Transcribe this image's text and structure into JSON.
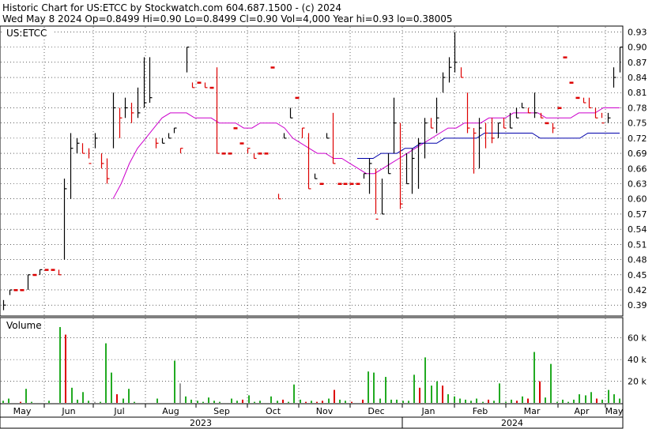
{
  "header": {
    "line1": "Historic Chart for US:ETCC by Stockwatch.com 604.687.1500 - (c) 2024",
    "line2": "Wed May  8 2024   Op=0.8499   Hi=0.90   Lo=0.8499   Cl=0.90   Vol=4,000   Year hi=0.93   lo=0.38005"
  },
  "symbol_label": "US:ETCC",
  "volume_label": "Volume",
  "colors": {
    "price_up": "#000000",
    "price_down": "#dd0000",
    "ma_short": "#cc00cc",
    "ma_long": "#0000aa",
    "vol_up": "#22aa22",
    "vol_down": "#dd0000",
    "vol_neutral": "#999999",
    "grid": "#000000"
  },
  "chart_data": [
    {
      "type": "line",
      "title": "US:ETCC",
      "y_ticks": [
        "0.93",
        "0.90",
        "0.87",
        "0.84",
        "0.81",
        "0.78",
        "0.75",
        "0.72",
        "0.69",
        "0.66",
        "0.63",
        "0.60",
        "0.57",
        "0.54",
        "0.51",
        "0.48",
        "0.45",
        "0.42",
        "0.39"
      ],
      "ylim": [
        0.37,
        0.94
      ],
      "x_month_labels": [
        "May",
        "Jun",
        "Jul",
        "Aug",
        "Sep",
        "Oct",
        "Nov",
        "Dec",
        "Jan",
        "Feb",
        "Mar",
        "Apr",
        "May"
      ],
      "x_year_labels": [
        "2023",
        "2024"
      ],
      "bars_hl_close": [
        [
          0.38,
          0.4,
          0.39
        ],
        [
          0.41,
          0.42,
          0.42
        ],
        [
          0.42,
          0.42,
          0.42
        ],
        [
          0.42,
          0.42,
          0.42
        ],
        [
          0.42,
          0.45,
          0.45
        ],
        [
          0.45,
          0.45,
          0.45
        ],
        [
          0.45,
          0.46,
          0.46
        ],
        [
          0.46,
          0.46,
          0.46
        ],
        [
          0.46,
          0.46,
          0.46
        ],
        [
          0.45,
          0.46,
          0.45
        ],
        [
          0.48,
          0.64,
          0.62
        ],
        [
          0.6,
          0.73,
          0.7
        ],
        [
          0.69,
          0.72,
          0.71
        ],
        [
          0.69,
          0.71,
          0.69
        ],
        [
          0.68,
          0.7,
          0.67
        ],
        [
          0.7,
          0.73,
          0.72
        ],
        [
          0.66,
          0.69,
          0.67
        ],
        [
          0.63,
          0.68,
          0.64
        ],
        [
          0.7,
          0.81,
          0.78
        ],
        [
          0.72,
          0.78,
          0.76
        ],
        [
          0.76,
          0.8,
          0.78
        ],
        [
          0.75,
          0.79,
          0.77
        ],
        [
          0.76,
          0.82,
          0.77
        ],
        [
          0.78,
          0.88,
          0.79
        ],
        [
          0.79,
          0.88,
          0.8
        ],
        [
          0.7,
          0.72,
          0.71
        ],
        [
          0.71,
          0.72,
          0.71
        ],
        [
          0.72,
          0.73,
          0.72
        ],
        [
          0.73,
          0.74,
          0.74
        ],
        [
          0.69,
          0.7,
          0.7
        ],
        [
          0.85,
          0.9,
          0.9
        ],
        [
          0.82,
          0.83,
          0.82
        ],
        [
          0.83,
          0.83,
          0.83
        ],
        [
          0.82,
          0.83,
          0.82
        ],
        [
          0.82,
          0.82,
          0.82
        ],
        [
          0.69,
          0.86,
          0.69
        ],
        [
          0.69,
          0.69,
          0.69
        ],
        [
          0.69,
          0.69,
          0.69
        ],
        [
          0.74,
          0.74,
          0.74
        ],
        [
          0.71,
          0.71,
          0.71
        ],
        [
          0.69,
          0.7,
          0.7
        ],
        [
          0.68,
          0.69,
          0.68
        ],
        [
          0.69,
          0.69,
          0.69
        ],
        [
          0.69,
          0.69,
          0.69
        ],
        [
          0.86,
          0.86,
          0.86
        ],
        [
          0.6,
          0.61,
          0.6
        ],
        [
          0.72,
          0.73,
          0.72
        ],
        [
          0.76,
          0.78,
          0.76
        ],
        [
          0.8,
          0.8,
          0.8
        ],
        [
          0.72,
          0.74,
          0.74
        ],
        [
          0.62,
          0.73,
          0.62
        ],
        [
          0.64,
          0.65,
          0.64
        ],
        [
          0.63,
          0.63,
          0.63
        ],
        [
          0.72,
          0.73,
          0.72
        ],
        [
          0.67,
          0.77,
          0.67
        ],
        [
          0.63,
          0.63,
          0.63
        ],
        [
          0.63,
          0.63,
          0.63
        ],
        [
          0.63,
          0.63,
          0.63
        ],
        [
          0.63,
          0.63,
          0.63
        ],
        [
          0.64,
          0.65,
          0.65
        ],
        [
          0.61,
          0.68,
          0.67
        ],
        [
          0.57,
          0.66,
          0.56
        ],
        [
          0.57,
          0.64,
          0.57
        ],
        [
          0.65,
          0.69,
          0.65
        ],
        [
          0.69,
          0.8,
          0.75
        ],
        [
          0.58,
          0.75,
          0.59
        ],
        [
          0.63,
          0.69,
          0.63
        ],
        [
          0.61,
          0.7,
          0.68
        ],
        [
          0.62,
          0.72,
          0.71
        ],
        [
          0.68,
          0.76,
          0.75
        ],
        [
          0.74,
          0.76,
          0.74
        ],
        [
          0.73,
          0.8,
          0.76
        ],
        [
          0.81,
          0.85,
          0.84
        ],
        [
          0.83,
          0.88,
          0.86
        ],
        [
          0.85,
          0.93,
          0.87
        ],
        [
          0.84,
          0.86,
          0.84
        ],
        [
          0.73,
          0.81,
          0.74
        ],
        [
          0.65,
          0.74,
          0.73
        ],
        [
          0.66,
          0.76,
          0.74
        ],
        [
          0.7,
          0.75,
          0.73
        ],
        [
          0.71,
          0.76,
          0.72
        ],
        [
          0.72,
          0.75,
          0.75
        ],
        [
          0.74,
          0.76,
          0.74
        ],
        [
          0.74,
          0.77,
          0.74
        ],
        [
          0.76,
          0.78,
          0.76
        ],
        [
          0.78,
          0.79,
          0.78
        ],
        [
          0.77,
          0.78,
          0.77
        ],
        [
          0.76,
          0.81,
          0.77
        ],
        [
          0.76,
          0.77,
          0.76
        ],
        [
          0.75,
          0.75,
          0.75
        ],
        [
          0.73,
          0.75,
          0.74
        ],
        [
          0.78,
          0.78,
          0.78
        ],
        [
          0.88,
          0.88,
          0.88
        ],
        [
          0.83,
          0.83,
          0.83
        ],
        [
          0.8,
          0.8,
          0.8
        ],
        [
          0.79,
          0.8,
          0.79
        ],
        [
          0.78,
          0.8,
          0.78
        ],
        [
          0.76,
          0.78,
          0.76
        ],
        [
          0.76,
          0.77,
          0.75
        ],
        [
          0.75,
          0.77,
          0.76
        ],
        [
          0.82,
          0.86,
          0.84
        ],
        [
          0.85,
          0.9,
          0.9
        ]
      ],
      "ma_short_points": [
        [
          0.6,
          0.63,
          0.67,
          0.7,
          0.72,
          0.74,
          0.76,
          0.77,
          0.77,
          0.77,
          0.76,
          0.76,
          0.76,
          0.75,
          0.75,
          0.75,
          0.74,
          0.74,
          0.75,
          0.75,
          0.75,
          0.74,
          0.72,
          0.71,
          0.7,
          0.69,
          0.69,
          0.68,
          0.68,
          0.67,
          0.66,
          0.65,
          0.65,
          0.66,
          0.67,
          0.68,
          0.69,
          0.7,
          0.71,
          0.72,
          0.73,
          0.74,
          0.74,
          0.75,
          0.75,
          0.75,
          0.76,
          0.76,
          0.76,
          0.77,
          0.77,
          0.77,
          0.77,
          0.76,
          0.76,
          0.76,
          0.76,
          0.77,
          0.77,
          0.77,
          0.78,
          0.78,
          0.78
        ]
      ],
      "ma_long_points": [
        [
          0.68,
          0.68,
          0.68,
          0.69,
          0.69,
          0.69,
          0.7,
          0.7,
          0.71,
          0.71,
          0.71,
          0.72,
          0.72,
          0.72,
          0.72,
          0.72,
          0.73,
          0.73,
          0.73,
          0.73,
          0.73,
          0.73,
          0.73,
          0.72,
          0.72,
          0.72,
          0.72,
          0.72,
          0.72,
          0.73,
          0.73,
          0.73,
          0.73,
          0.73
        ]
      ]
    },
    {
      "type": "bar",
      "title": "Volume",
      "y_ticks": [
        "60 k",
        "40 k",
        "20 k"
      ],
      "ylim": [
        0,
        78000
      ],
      "values": [
        2000,
        4000,
        0,
        1000,
        13000,
        1000,
        0,
        0,
        2000,
        0,
        70000,
        63000,
        14000,
        3000,
        10000,
        2000,
        1000,
        1000,
        55000,
        28000,
        8000,
        4000,
        13000,
        1000,
        0,
        0,
        0,
        4000,
        0,
        0,
        39000,
        18000,
        6000,
        3000,
        2000,
        1000,
        5000,
        2000,
        1000,
        0,
        4000,
        2000,
        3000,
        7000,
        1000,
        2000,
        0,
        6000,
        2000,
        3000,
        1000,
        17000,
        3000,
        1000,
        2000,
        1000,
        2000,
        4000,
        12000,
        3000,
        2000,
        1000,
        0,
        3000,
        29000,
        28000,
        4000,
        24000,
        3000,
        3000,
        2000,
        2000,
        26000,
        14000,
        42000,
        16000,
        20000,
        16000,
        8000,
        6000,
        4000,
        3000,
        2000,
        4000,
        1000,
        3000,
        2000,
        18000,
        1000,
        3000,
        2000,
        6000,
        4000,
        47000,
        20000,
        5000,
        36000,
        1000,
        3000,
        1000,
        3000,
        8000,
        7000,
        10000,
        4000,
        3000,
        12000,
        8000,
        4000
      ],
      "colors_code": "gggrgggggggrggggngggrggggggggggngggggggrggrggggggrgggrgrrgrggrrrgggggggggrgggrgggggggrggggrgrgrgggggggggrgg"
    }
  ]
}
